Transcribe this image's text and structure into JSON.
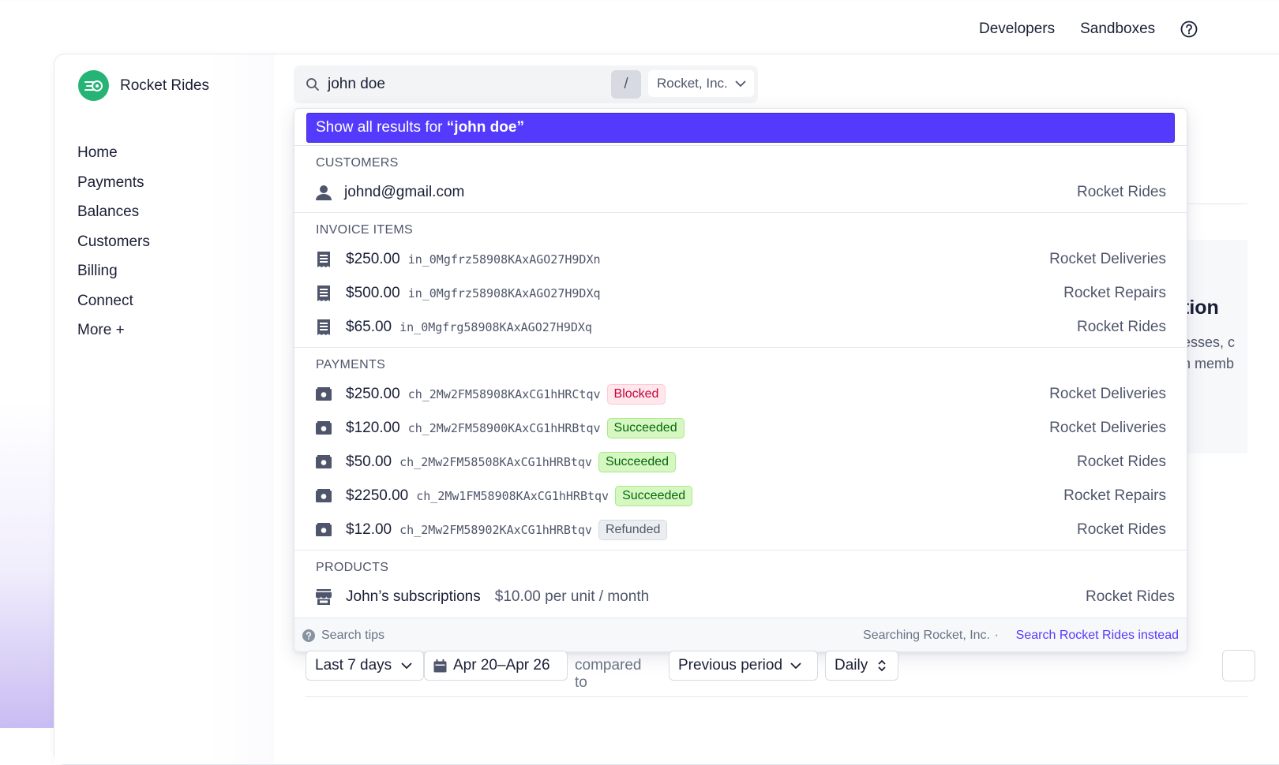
{
  "brand": {
    "name": "Rocket Rides",
    "accent": "#26b376"
  },
  "nav": [
    "Home",
    "Payments",
    "Balances",
    "Customers",
    "Billing",
    "Connect",
    "More +"
  ],
  "topbar": {
    "developers": "Developers",
    "sandboxes": "Sandboxes",
    "help_icon": "help-circle-icon"
  },
  "search": {
    "value": "john doe",
    "shortcut": "/",
    "account": "Rocket, Inc."
  },
  "dropdown": {
    "show_all_prefix": "Show all results for ",
    "show_all_query": "“john doe”",
    "customers": {
      "title": "CUSTOMERS",
      "items": [
        {
          "email": "johnd@gmail.com",
          "account": "Rocket Rides"
        }
      ]
    },
    "invoice_items": {
      "title": "INVOICE ITEMS",
      "items": [
        {
          "amount": "$250.00",
          "id": "in_0Mgfrz58908KAxAGO27H9DXn",
          "account": "Rocket Deliveries"
        },
        {
          "amount": "$500.00",
          "id": "in_0Mgfrz58908KAxAGO27H9DXq",
          "account": "Rocket Repairs"
        },
        {
          "amount": "$65.00",
          "id": "in_0Mgfrg58908KAxAGO27H9DXq",
          "account": "Rocket Rides"
        }
      ]
    },
    "payments": {
      "title": "PAYMENTS",
      "items": [
        {
          "amount": "$250.00",
          "id": "ch_2Mw2FM58908KAxCG1hHRCtqv",
          "status": "Blocked",
          "account": "Rocket Deliveries"
        },
        {
          "amount": "$120.00",
          "id": "ch_2Mw2FM58900KAxCG1hHRBtqv",
          "status": "Succeeded",
          "account": "Rocket Deliveries"
        },
        {
          "amount": "$50.00",
          "id": "ch_2Mw2FM58508KAxCG1hHRBtqv",
          "status": "Succeeded",
          "account": "Rocket Rides"
        },
        {
          "amount": "$2250.00",
          "id": "ch_2Mw1FM58908KAxCG1hHRBtqv",
          "status": "Succeeded",
          "account": "Rocket Repairs"
        },
        {
          "amount": "$12.00",
          "id": "ch_2Mw2FM58902KAxCG1hHRBtqv",
          "status": "Refunded",
          "account": "Rocket Rides"
        }
      ]
    },
    "products": {
      "title": "PRODUCTS",
      "items": [
        {
          "name": "John’s subscriptions",
          "price": "$10.00 per unit / month",
          "account": "Rocket Rides"
        }
      ]
    },
    "footer": {
      "tips": "Search tips",
      "searching": "Searching Rocket, Inc.",
      "separator": "·",
      "link": "Search Rocket Rides instead"
    }
  },
  "background": {
    "title_fragment": "tion",
    "line1": "esses, c",
    "line2": "n memb"
  },
  "filters": {
    "range": "Last 7 days",
    "dates": "Apr 20–Apr 26",
    "compared_to": "compared to",
    "comparison": "Previous period",
    "interval": "Daily"
  },
  "colors": {
    "primary": "#533afd",
    "blocked": "#c3023b",
    "succeeded": "#006908",
    "refunded": "#545969"
  }
}
